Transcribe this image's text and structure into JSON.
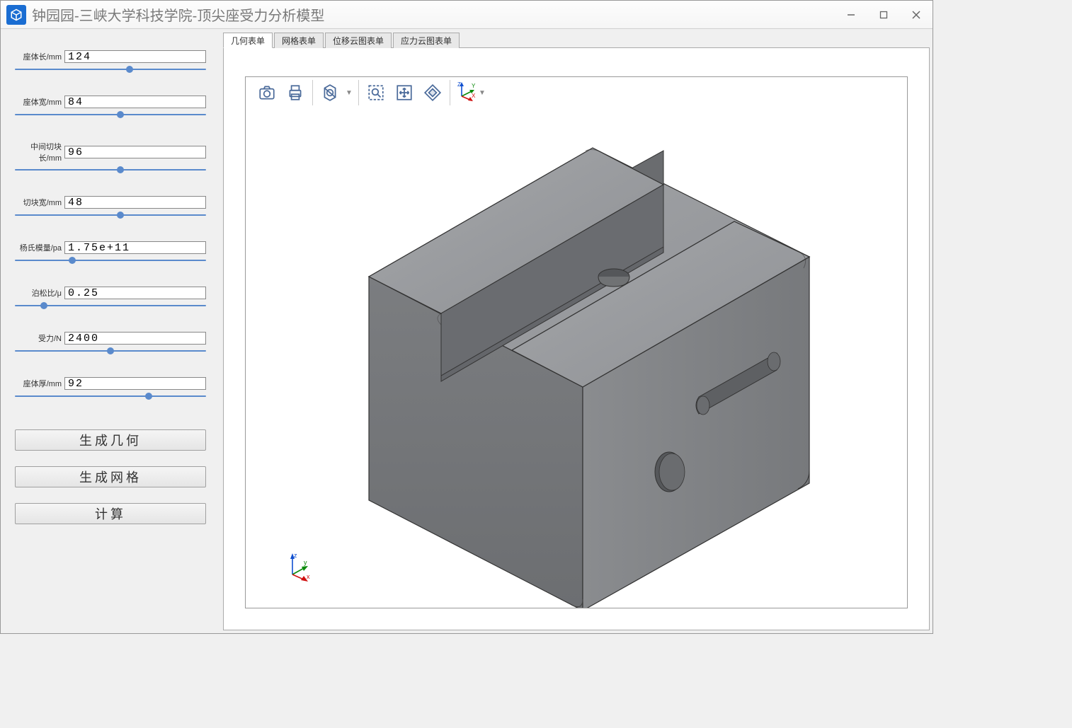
{
  "window": {
    "title": "钟园园-三峡大学科技学院-顶尖座受力分析模型"
  },
  "sidebar": {
    "params": [
      {
        "label": "座体长/mm",
        "value": "124",
        "thumb_pct": 60
      },
      {
        "label": "座体宽/mm",
        "value": "84",
        "thumb_pct": 55
      },
      {
        "label": "中间切块长/mm",
        "value": "96",
        "thumb_pct": 55
      },
      {
        "label": "切块宽/mm",
        "value": "48",
        "thumb_pct": 55
      },
      {
        "label": "杨氏模量/pa",
        "value": "1.75e+11",
        "thumb_pct": 30
      },
      {
        "label": "泊松比/μ",
        "value": "0.25",
        "thumb_pct": 15
      },
      {
        "label": "受力/N",
        "value": "2400",
        "thumb_pct": 50
      },
      {
        "label": "座体厚/mm",
        "value": "92",
        "thumb_pct": 70
      }
    ],
    "buttons": {
      "generate_geometry": "生成几何",
      "generate_mesh": "生成网格",
      "calculate": "计算"
    }
  },
  "tabs": [
    {
      "label": "几何表单",
      "active": true
    },
    {
      "label": "网格表单",
      "active": false
    },
    {
      "label": "位移云图表单",
      "active": false
    },
    {
      "label": "应力云图表单",
      "active": false
    }
  ],
  "axes": {
    "x": "x",
    "y": "y",
    "z": "z",
    "X": "X",
    "Y": "Y",
    "Z": "Z"
  }
}
